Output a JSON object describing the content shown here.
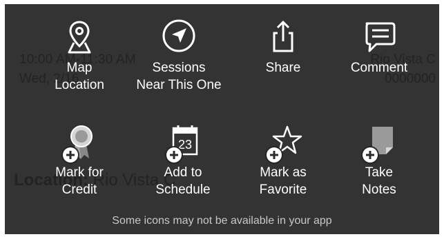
{
  "background_page": {
    "time": "10:00 AM-11:30 AM",
    "day": "Wed, 2/16",
    "place": "Rio Vista C",
    "code": "0000000",
    "location_label": "Location:",
    "location_value": "Rio Vista C"
  },
  "actions": [
    {
      "id": "map-location",
      "label": "Map\nLocation",
      "icon": "map-pin-icon"
    },
    {
      "id": "sessions-near",
      "label": "Sessions\nNear This One",
      "icon": "navigation-arrow-icon"
    },
    {
      "id": "share",
      "label": "Share",
      "icon": "share-icon"
    },
    {
      "id": "comment",
      "label": "Comment",
      "icon": "comment-icon"
    },
    {
      "id": "mark-for-credit",
      "label": "Mark for\nCredit",
      "icon": "award-ribbon-icon"
    },
    {
      "id": "add-to-schedule",
      "label": "Add to\nSchedule",
      "icon": "calendar-icon"
    },
    {
      "id": "mark-as-favorite",
      "label": "Mark as\nFavorite",
      "icon": "star-icon"
    },
    {
      "id": "take-notes",
      "label": "Take\nNotes",
      "icon": "note-icon"
    }
  ],
  "calendar_day": "23",
  "footer_text": "Some icons may not be available in your app",
  "colors": {
    "overlay": "#242424",
    "text": "#ffffff",
    "footer_text": "#c9c9c9"
  }
}
